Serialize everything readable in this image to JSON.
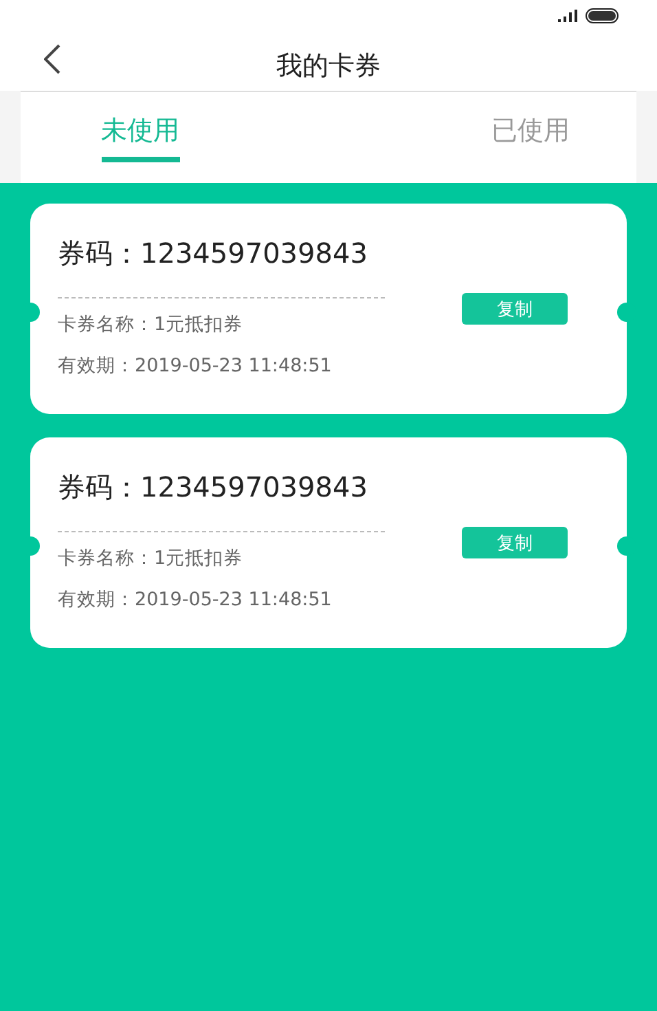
{
  "header": {
    "title": "我的卡券"
  },
  "tabs": [
    {
      "label": "未使用",
      "selected": true
    },
    {
      "label": "已使用",
      "selected": false
    }
  ],
  "coupons": [
    {
      "code": "券码：1234597039843",
      "name": "卡券名称：1元抵扣券",
      "expiry": "有效期：2019-05-23 11:48:51",
      "button": "复制"
    },
    {
      "code": "券码：1234597039843",
      "name": "卡券名称：1元抵扣券",
      "expiry": "有效期：2019-05-23 11:48:51",
      "button": "复制"
    }
  ]
}
